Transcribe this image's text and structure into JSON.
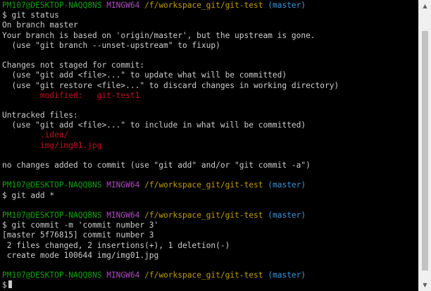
{
  "terminal": {
    "lines": [
      {
        "segments": [
          {
            "text": "PM107@DESKTOP-NAQQ8NS",
            "color": "#13a10e"
          },
          {
            "text": " ",
            "color": "#cccccc"
          },
          {
            "text": "MINGW64",
            "color": "#b148c6"
          },
          {
            "text": " ",
            "color": "#cccccc"
          },
          {
            "text": "/f/workspace_git/git-test",
            "color": "#c19c00"
          },
          {
            "text": " ",
            "color": "#cccccc"
          },
          {
            "text": "(master)",
            "color": "#3a96dd"
          }
        ]
      },
      {
        "segments": [
          {
            "text": "$ git status",
            "color": "#cccccc"
          }
        ]
      },
      {
        "segments": [
          {
            "text": "On branch master",
            "color": "#cccccc"
          }
        ]
      },
      {
        "segments": [
          {
            "text": "Your branch is based on 'origin/master', but the upstream is gone.",
            "color": "#cccccc"
          }
        ]
      },
      {
        "segments": [
          {
            "text": "  (use \"git branch --unset-upstream\" to fixup)",
            "color": "#cccccc"
          }
        ]
      },
      {
        "segments": [
          {
            "text": "",
            "color": "#cccccc"
          }
        ]
      },
      {
        "segments": [
          {
            "text": "Changes not staged for commit:",
            "color": "#cccccc"
          }
        ]
      },
      {
        "segments": [
          {
            "text": "  (use \"git add <file>...\" to update what will be committed)",
            "color": "#cccccc"
          }
        ]
      },
      {
        "segments": [
          {
            "text": "  (use \"git restore <file>...\" to discard changes in working directory)",
            "color": "#cccccc"
          }
        ]
      },
      {
        "segments": [
          {
            "text": "        modified:   git-test1",
            "color": "#c50f1f"
          }
        ]
      },
      {
        "segments": [
          {
            "text": "",
            "color": "#cccccc"
          }
        ]
      },
      {
        "segments": [
          {
            "text": "Untracked files:",
            "color": "#cccccc"
          }
        ]
      },
      {
        "segments": [
          {
            "text": "  (use \"git add <file>...\" to include in what will be committed)",
            "color": "#cccccc"
          }
        ]
      },
      {
        "segments": [
          {
            "text": "        .idea/",
            "color": "#c50f1f"
          }
        ]
      },
      {
        "segments": [
          {
            "text": "        img/img01.jpg",
            "color": "#c50f1f"
          }
        ]
      },
      {
        "segments": [
          {
            "text": "",
            "color": "#cccccc"
          }
        ]
      },
      {
        "segments": [
          {
            "text": "no changes added to commit (use \"git add\" and/or \"git commit -a\")",
            "color": "#cccccc"
          }
        ]
      },
      {
        "segments": [
          {
            "text": "",
            "color": "#cccccc"
          }
        ]
      },
      {
        "segments": [
          {
            "text": "PM107@DESKTOP-NAQQ8NS",
            "color": "#13a10e"
          },
          {
            "text": " ",
            "color": "#cccccc"
          },
          {
            "text": "MINGW64",
            "color": "#b148c6"
          },
          {
            "text": " ",
            "color": "#cccccc"
          },
          {
            "text": "/f/workspace_git/git-test",
            "color": "#c19c00"
          },
          {
            "text": " ",
            "color": "#cccccc"
          },
          {
            "text": "(master)",
            "color": "#3a96dd"
          }
        ]
      },
      {
        "segments": [
          {
            "text": "$ git add *",
            "color": "#cccccc"
          }
        ]
      },
      {
        "segments": [
          {
            "text": "",
            "color": "#cccccc"
          }
        ]
      },
      {
        "segments": [
          {
            "text": "PM107@DESKTOP-NAQQ8NS",
            "color": "#13a10e"
          },
          {
            "text": " ",
            "color": "#cccccc"
          },
          {
            "text": "MINGW64",
            "color": "#b148c6"
          },
          {
            "text": " ",
            "color": "#cccccc"
          },
          {
            "text": "/f/workspace_git/git-test",
            "color": "#c19c00"
          },
          {
            "text": " ",
            "color": "#cccccc"
          },
          {
            "text": "(master)",
            "color": "#3a96dd"
          }
        ]
      },
      {
        "segments": [
          {
            "text": "$ git commit -m 'commit number 3'",
            "color": "#cccccc"
          }
        ]
      },
      {
        "segments": [
          {
            "text": "[master 5f76815] commit number 3",
            "color": "#cccccc"
          }
        ]
      },
      {
        "segments": [
          {
            "text": " 2 files changed, 2 insertions(+), 1 deletion(-)",
            "color": "#cccccc"
          }
        ]
      },
      {
        "segments": [
          {
            "text": " create mode 100644 img/img01.jpg",
            "color": "#cccccc"
          }
        ]
      },
      {
        "segments": [
          {
            "text": "",
            "color": "#cccccc"
          }
        ]
      },
      {
        "segments": [
          {
            "text": "PM107@DESKTOP-NAQQ8NS",
            "color": "#13a10e"
          },
          {
            "text": " ",
            "color": "#cccccc"
          },
          {
            "text": "MINGW64",
            "color": "#b148c6"
          },
          {
            "text": " ",
            "color": "#cccccc"
          },
          {
            "text": "/f/workspace_git/git-test",
            "color": "#c19c00"
          },
          {
            "text": " ",
            "color": "#cccccc"
          },
          {
            "text": "(master)",
            "color": "#3a96dd"
          }
        ]
      },
      {
        "segments": [
          {
            "text": "$",
            "color": "#cccccc"
          }
        ],
        "cursor": true
      }
    ]
  },
  "colors": {
    "background": "#000000",
    "foreground": "#cccccc",
    "user_host": "#13a10e",
    "shell": "#b148c6",
    "path": "#c19c00",
    "branch": "#3a96dd",
    "git_status_red": "#c50f1f"
  },
  "scrollbar": {
    "up_icon": "triangle-up-icon",
    "down_icon": "triangle-down-icon"
  }
}
